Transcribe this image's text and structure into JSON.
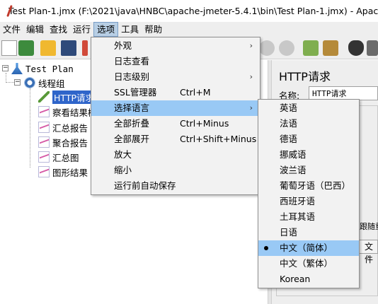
{
  "window": {
    "title": "Test Plan-1.jmx (F:\\2021\\java\\HNBC\\apache-jmeter-5.4.1\\bin\\Test Plan-1.jmx) - Apache J"
  },
  "menubar": {
    "items": [
      "文件",
      "编辑",
      "查找",
      "运行",
      "选项",
      "工具",
      "帮助"
    ],
    "active_index": 4
  },
  "tree": {
    "root": "Test Plan",
    "thread_group": "线程组",
    "children": [
      "HTTP请求",
      "察看结果树",
      "汇总报告",
      "聚合报告",
      "汇总图",
      "图形结果"
    ]
  },
  "right_panel": {
    "title": "HTTP请求",
    "name_label": "名称:",
    "name_value": "HTTP请求",
    "follow_text": "跟随重",
    "file_button": "文件"
  },
  "options_menu": {
    "items": [
      {
        "label": "外观",
        "accel": "",
        "submenu": true
      },
      {
        "label": "日志查看",
        "accel": "",
        "submenu": false
      },
      {
        "label": "日志级别",
        "accel": "",
        "submenu": true
      },
      {
        "label": "SSL管理器",
        "accel": "Ctrl+M",
        "submenu": false
      },
      {
        "label": "选择语言",
        "accel": "",
        "submenu": true
      },
      {
        "label": "全部折叠",
        "accel": "Ctrl+Minus",
        "submenu": false
      },
      {
        "label": "全部展开",
        "accel": "Ctrl+Shift+Minus",
        "submenu": false
      },
      {
        "label": "放大",
        "accel": "",
        "submenu": false
      },
      {
        "label": "缩小",
        "accel": "",
        "submenu": false
      },
      {
        "label": "运行前自动保存",
        "accel": "",
        "submenu": false
      }
    ],
    "highlighted_index": 4
  },
  "language_menu": {
    "items": [
      "英语",
      "法语",
      "德语",
      "挪威语",
      "波兰语",
      "葡萄牙语（巴西）",
      "西班牙语",
      "土耳其语",
      "日语",
      "中文（简体）",
      "中文（繁体）",
      "Korean"
    ],
    "selected_index": 9
  },
  "colors": {
    "menu_highlight": "#99c9f5",
    "tree_selection": "#2f65ca"
  }
}
